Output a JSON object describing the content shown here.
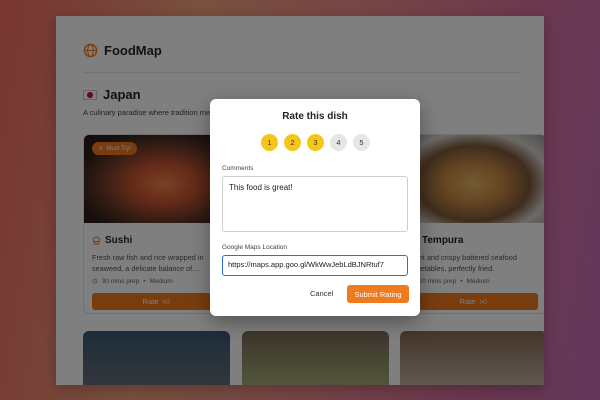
{
  "app": {
    "title": "FoodMap"
  },
  "country": {
    "name": "Japan",
    "description": "A culinary paradise where tradition me"
  },
  "cards": [
    {
      "badge": "Must Try!",
      "title": "Sushi",
      "description": "Fresh raw fish and rice wrapped in seaweed, a delicate balance of…",
      "prep": "30 mins prep",
      "level": "Medium",
      "button": "Rate"
    },
    {
      "title": "Tempura",
      "description": "Light and crispy battered seafood vegetables, perfectly fried.",
      "prep": "20 mins prep",
      "level": "Medium",
      "button": "Rate"
    }
  ],
  "modal": {
    "title": "Rate this dish",
    "rating": {
      "options": [
        "1",
        "2",
        "3",
        "4",
        "5"
      ],
      "selected": 3
    },
    "comments_label": "Comments",
    "comments_value": "This food is great!",
    "location_label": "Google Maps Location",
    "location_value": "https://maps.app.goo.gl/WkWwJebLdBJNRtuf7",
    "cancel_label": "Cancel",
    "submit_label": "Submit Rating"
  },
  "colors": {
    "accent": "#f07a1e",
    "star_active": "#f5c518",
    "focus": "#2a6fd6"
  }
}
